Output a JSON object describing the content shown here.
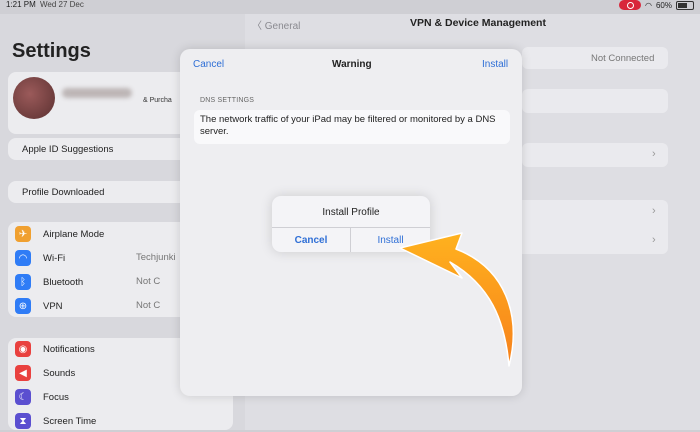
{
  "status_bar": {
    "time": "1:21 PM",
    "date": "Wed 27 Dec",
    "battery": "60%"
  },
  "sidebar": {
    "title": "Settings",
    "profile_subtext": "& Purcha",
    "apple_id_suggestions": "Apple ID Suggestions",
    "profile_downloaded": "Profile Downloaded",
    "group1": [
      {
        "label": "Airplane Mode",
        "value": "",
        "icon": "airplane-icon",
        "color": "#f0a030",
        "glyph": "✈"
      },
      {
        "label": "Wi-Fi",
        "value": "Techjunki",
        "icon": "wifi-icon",
        "color": "#2f7cf6",
        "glyph": "◠"
      },
      {
        "label": "Bluetooth",
        "value": "Not C",
        "icon": "bluetooth-icon",
        "color": "#2f7cf6",
        "glyph": "ᛒ"
      },
      {
        "label": "VPN",
        "value": "Not C",
        "icon": "vpn-icon",
        "color": "#2f7cf6",
        "glyph": "⊕"
      }
    ],
    "group2": [
      {
        "label": "Notifications",
        "icon": "notifications-icon",
        "color": "#e9413f",
        "glyph": "◉"
      },
      {
        "label": "Sounds",
        "icon": "sounds-icon",
        "color": "#e9413f",
        "glyph": "◀"
      },
      {
        "label": "Focus",
        "icon": "focus-icon",
        "color": "#5b4fd0",
        "glyph": "☾"
      },
      {
        "label": "Screen Time",
        "icon": "screen-time-icon",
        "color": "#5b4fd0",
        "glyph": "⧗"
      }
    ]
  },
  "right_panel": {
    "back_label": "General",
    "title": "VPN & Device Management",
    "vpn_status": "Not Connected"
  },
  "sheet": {
    "cancel_label": "Cancel",
    "title": "Warning",
    "install_label": "Install",
    "section_label": "DNS SETTINGS",
    "warning_text": "The network traffic of your iPad may be filtered or monitored by a DNS server."
  },
  "alert": {
    "title": "Install Profile",
    "cancel_label": "Cancel",
    "install_label": "Install"
  },
  "colors": {
    "accent": "#2f6fd6",
    "arrow": "#f7961d"
  }
}
